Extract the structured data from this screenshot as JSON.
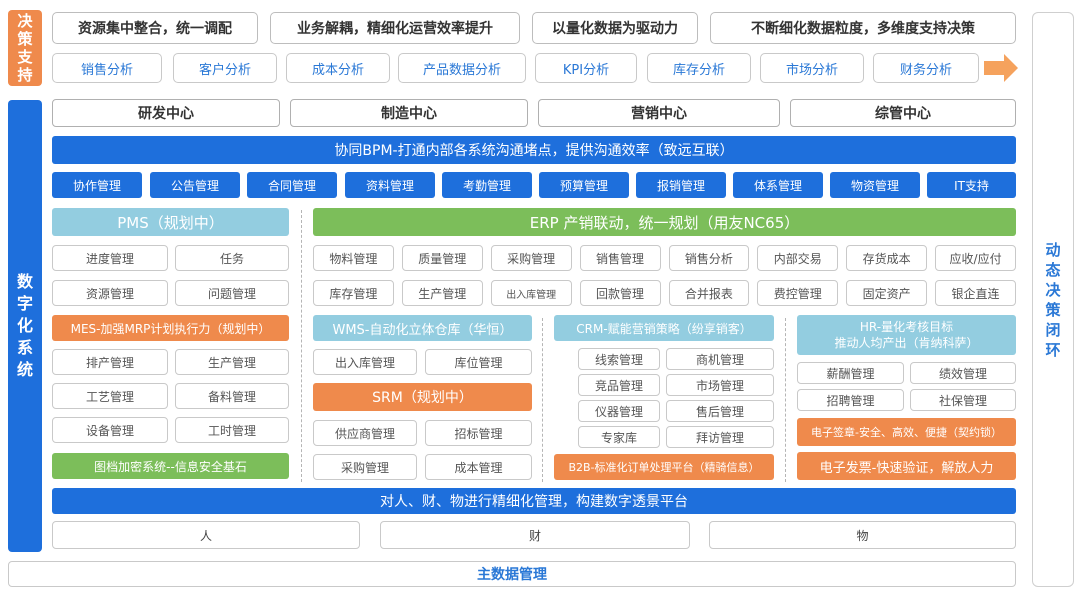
{
  "left_top_label": [
    "决",
    "策",
    "支",
    "持"
  ],
  "left_main_label": [
    "数",
    "字",
    "化",
    "系",
    "统"
  ],
  "right_label": [
    "动",
    "态",
    "决",
    "策",
    "闭",
    "环"
  ],
  "top_heads": [
    "资源集中整合，统一调配",
    "业务解耦，精细化运营效率提升",
    "以量化数据为驱动力",
    "不断细化数据粒度，多维度支持决策"
  ],
  "analysis_items": [
    "销售分析",
    "客户分析",
    "成本分析",
    "产品数据分析",
    "KPI分析",
    "库存分析",
    "市场分析",
    "财务分析"
  ],
  "centers": [
    "研发中心",
    "制造中心",
    "营销中心",
    "综管中心"
  ],
  "bpm_bar": "协同BPM-打通内部各系统沟通堵点，提供沟通效率（致远互联）",
  "bpm_items": [
    "协作管理",
    "公告管理",
    "合同管理",
    "资料管理",
    "考勤管理",
    "预算管理",
    "报销管理",
    "体系管理",
    "物资管理",
    "IT支持"
  ],
  "pms": {
    "title": "PMS（规划中）",
    "items": [
      "进度管理",
      "任务",
      "资源管理",
      "问题管理"
    ]
  },
  "mes": {
    "title": "MES-加强MRP计划执行力（规划中）",
    "items": [
      "排产管理",
      "生产管理",
      "工艺管理",
      "备料管理",
      "设备管理",
      "工时管理"
    ],
    "footer": "图档加密系统--信息安全基石"
  },
  "erp": {
    "title": "ERP 产销联动，统一规划（用友NC65）",
    "items": [
      "物料管理",
      "质量管理",
      "采购管理",
      "销售管理",
      "销售分析",
      "内部交易",
      "存货成本",
      "应收/应付",
      "库存管理",
      "生产管理",
      "出入库管理",
      "回款管理",
      "合并报表",
      "费控管理",
      "固定资产",
      "银企直连"
    ]
  },
  "wms": {
    "title": "WMS-自动化立体仓库（华恒）",
    "items": [
      "出入库管理",
      "库位管理"
    ]
  },
  "srm": {
    "title": "SRM（规划中）",
    "items": [
      "供应商管理",
      "招标管理",
      "采购管理",
      "成本管理"
    ]
  },
  "crm": {
    "title": "CRM-赋能营销策略（纷享销客）",
    "items": [
      "线索管理",
      "商机管理",
      "竞品管理",
      "市场管理",
      "仪器管理",
      "售后管理",
      "专家库",
      "拜访管理"
    ],
    "footer": "B2B-标准化订单处理平台（精骑信息）"
  },
  "hr": {
    "title_line1": "HR-量化考核目标",
    "title_line2": "推动人均产出（肯纳科萨）",
    "items": [
      "薪酬管理",
      "绩效管理",
      "招聘管理",
      "社保管理"
    ],
    "esign": "电子签章-安全、高效、便捷（契约锁）",
    "einvoice": "电子发票-快速验证，解放人力"
  },
  "bottom_bar": "对人、财、物进行精细化管理，构建数字透景平台",
  "footers": [
    "人",
    "财",
    "物"
  ],
  "master_data": "主数据管理",
  "colors": {
    "blue": "#1e6fdc",
    "orange": "#ef8a4c",
    "green": "#7cbe5a",
    "light_blue": "#93cde0"
  }
}
